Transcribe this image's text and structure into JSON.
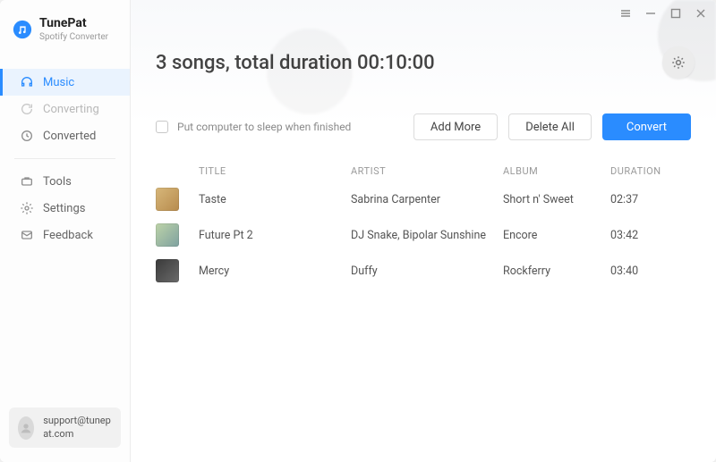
{
  "brand": {
    "name": "TunePat",
    "subtitle": "Spotify Converter"
  },
  "sidebar": {
    "items": [
      {
        "label": "Music"
      },
      {
        "label": "Converting"
      },
      {
        "label": "Converted"
      },
      {
        "label": "Tools"
      },
      {
        "label": "Settings"
      },
      {
        "label": "Feedback"
      }
    ]
  },
  "support": {
    "email": "support@tunepat.com"
  },
  "header": {
    "title": "3 songs, total duration 00:10:00"
  },
  "actions": {
    "sleep_label": "Put computer to sleep when finished",
    "add_more": "Add More",
    "delete_all": "Delete All",
    "convert": "Convert"
  },
  "table": {
    "headers": {
      "title": "TITLE",
      "artist": "ARTIST",
      "album": "ALBUM",
      "duration": "DURATION"
    },
    "rows": [
      {
        "title": "Taste",
        "artist": "Sabrina Carpenter",
        "album": "Short n' Sweet",
        "duration": "02:37"
      },
      {
        "title": "Future Pt 2",
        "artist": "DJ Snake, Bipolar Sunshine",
        "album": "Encore",
        "duration": "03:42"
      },
      {
        "title": "Mercy",
        "artist": "Duffy",
        "album": "Rockferry",
        "duration": "03:40"
      }
    ]
  }
}
